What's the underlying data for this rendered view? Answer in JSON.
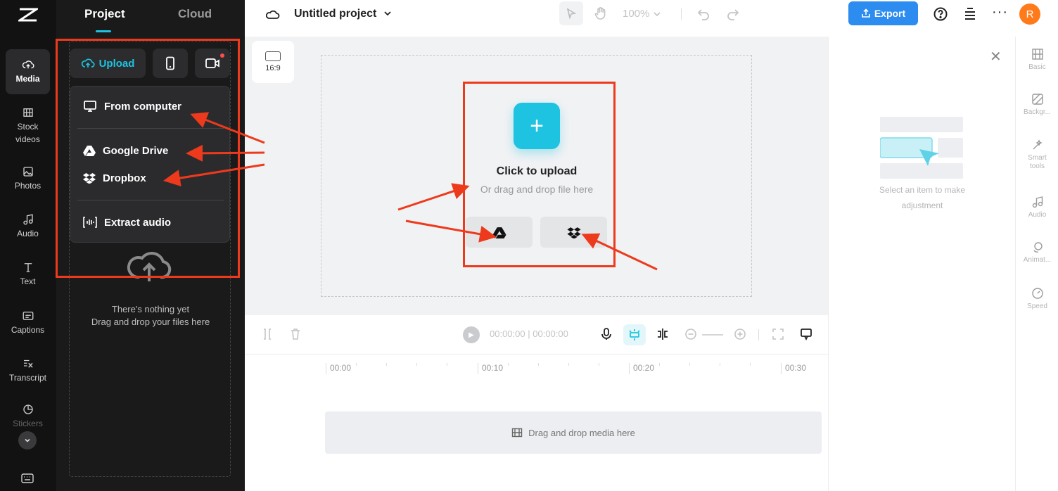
{
  "left_rail": {
    "items": [
      {
        "label": "Media",
        "icon": "cloud-upload-icon"
      },
      {
        "label": "Stock videos",
        "icon": "film-icon"
      },
      {
        "label": "Photos",
        "icon": "image-icon"
      },
      {
        "label": "Audio",
        "icon": "music-note-icon"
      },
      {
        "label": "Text",
        "icon": "text-t-icon"
      },
      {
        "label": "Captions",
        "icon": "captions-icon"
      },
      {
        "label": "Transcript",
        "icon": "transcript-icon"
      },
      {
        "label": "Stickers",
        "icon": "sticker-icon"
      }
    ]
  },
  "media_panel": {
    "tabs": [
      "Project",
      "Cloud"
    ],
    "upload_label": "Upload",
    "menu": {
      "from_computer": "From computer",
      "google_drive": "Google Drive",
      "dropbox": "Dropbox",
      "extract_audio": "Extract audio"
    },
    "empty_title": "There's nothing yet",
    "empty_hint": "Drag and drop your files here"
  },
  "topbar": {
    "project_title": "Untitled project",
    "zoom": "100%",
    "export_label": "Export",
    "avatar_initial": "R"
  },
  "canvas": {
    "ratio": "16:9",
    "upload_title": "Click to upload",
    "upload_sub": "Or drag and drop file here"
  },
  "player": {
    "current_time": "00:00:00",
    "total_time": "00:00:00",
    "time_sep": "|"
  },
  "timeline": {
    "ticks": [
      "00:00",
      "00:10",
      "00:20",
      "00:30"
    ],
    "drop_label": "Drag and drop media here"
  },
  "properties": {
    "hint_line1": "Select an item to make",
    "hint_line2": "adjustment"
  },
  "right_rail": {
    "items": [
      "Basic",
      "Backgr...",
      "Smart tools",
      "Audio",
      "Animat...",
      "Speed"
    ]
  },
  "colors": {
    "accent": "#1dc3e0",
    "export": "#2d8cf0",
    "annotation": "#ee3a1c",
    "avatar": "#ff7a1a"
  }
}
